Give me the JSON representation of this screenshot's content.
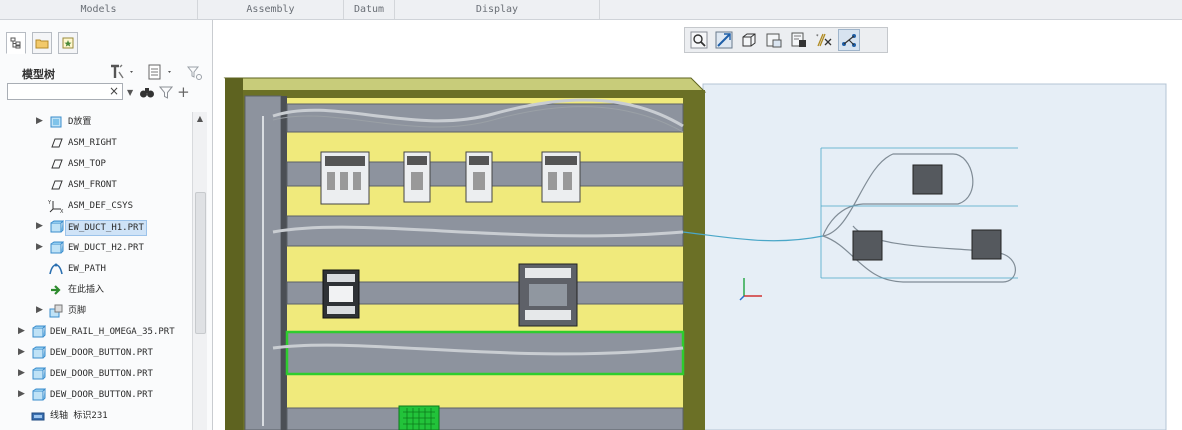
{
  "ribbon": {
    "tabs": [
      "Models",
      "Assembly",
      "Datum",
      "Display"
    ]
  },
  "panel": {
    "title": "模型树",
    "search": {
      "value": "",
      "placeholder": ""
    },
    "tree": [
      {
        "label": "D放置",
        "icon": "folder-icon",
        "expand": true
      },
      {
        "label": "ASM_RIGHT",
        "icon": "datum-plane-icon",
        "expand": false
      },
      {
        "label": "ASM_TOP",
        "icon": "datum-plane-icon",
        "expand": false
      },
      {
        "label": "ASM_FRONT",
        "icon": "datum-plane-icon",
        "expand": false
      },
      {
        "label": "ASM_DEF_CSYS",
        "icon": "csys-icon",
        "expand": false
      },
      {
        "label": "EW_DUCT_H1.PRT",
        "icon": "part-icon",
        "expand": true,
        "selected": true
      },
      {
        "label": "EW_DUCT_H2.PRT",
        "icon": "part-icon",
        "expand": true
      },
      {
        "label": "EW_PATH",
        "icon": "path-icon",
        "expand": false
      },
      {
        "label": "在此插入",
        "icon": "insert-arrow-icon",
        "expand": false
      },
      {
        "label": "页脚",
        "icon": "footer-icon",
        "expand": true
      },
      {
        "label": "DEW_RAIL_H_OMEGA_35.PRT",
        "icon": "part-icon",
        "expand": true
      },
      {
        "label": "DEW_DOOR_BUTTON.PRT",
        "icon": "part-icon",
        "expand": true
      },
      {
        "label": "DEW_DOOR_BUTTON.PRT",
        "icon": "part-icon",
        "expand": true
      },
      {
        "label": "DEW_DOOR_BUTTON.PRT",
        "icon": "part-icon",
        "expand": true
      },
      {
        "label": "线轴 标识231",
        "icon": "spool-icon",
        "expand": false
      }
    ]
  },
  "view_toolbar": {
    "buttons": [
      "zoom-icon",
      "refit-icon",
      "display-style-icon",
      "saved-views-icon",
      "view-manager-icon",
      "datum-display-icon",
      "annotation-display-icon"
    ],
    "active": "annotation-display-icon"
  },
  "colors": {
    "cabinet_frame": "#5e6320",
    "cabinet_back": "#f0ea7c",
    "duct": "#8d939e",
    "door": "#e6eef6",
    "selection": "#2ecc2e",
    "wire": "#4aa7c8"
  }
}
